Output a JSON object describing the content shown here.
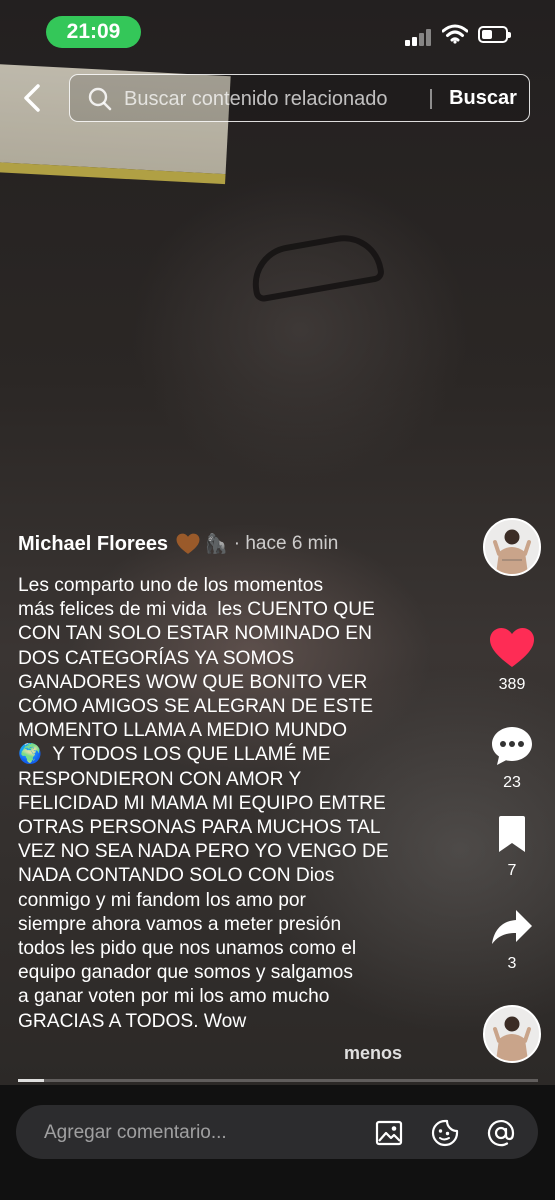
{
  "status_bar": {
    "time": "21:09",
    "battery_level": 0.4
  },
  "search": {
    "placeholder": "Buscar contenido relacionado",
    "button_label": "Buscar"
  },
  "post": {
    "author": "Michael Florees",
    "author_emojis": [
      "brown-heart",
      "gorilla"
    ],
    "time_ago": "· hace 6 min",
    "caption_lines": [
      "Les comparto uno de los momentos",
      "más felices de mi vida  les CUENTO QUE",
      "CON TAN SOLO ESTAR NOMINADO EN",
      "DOS CATEGORÍAS YA SOMOS",
      "GANADORES WOW QUE BONITO VER",
      "CÓMO AMIGOS SE ALEGRAN DE ESTE",
      "MOMENTO LLAMA A MEDIO MUNDO",
      "🌍  Y TODOS LOS QUE LLAMÉ ME",
      "RESPONDIERON CON AMOR Y",
      "FELICIDAD MI MAMA MI EQUIPO EMTRE",
      "OTRAS PERSONAS PARA MUCHOS TAL",
      "VEZ NO SEA NADA PERO YO VENGO DE",
      "NADA CONTANDO SOLO CON Dios",
      "conmigo y mi fandom los amo por",
      "siempre ahora vamos a meter presión",
      "todos les pido que nos unamos como el",
      "equipo ganador que somos y salgamos",
      "a ganar voten por mi los amo mucho",
      "GRACIAS A TODOS. Wow"
    ],
    "less_label": "menos",
    "progress": 0.05
  },
  "actions": {
    "likes": "389",
    "comments": "23",
    "saves": "7",
    "shares": "3"
  },
  "colors": {
    "like": "#fe2c55",
    "status_pill": "#34c759"
  },
  "comment_bar": {
    "placeholder": "Agregar comentario...",
    "icons": [
      "image-icon",
      "sticker-icon",
      "mention-icon"
    ]
  }
}
